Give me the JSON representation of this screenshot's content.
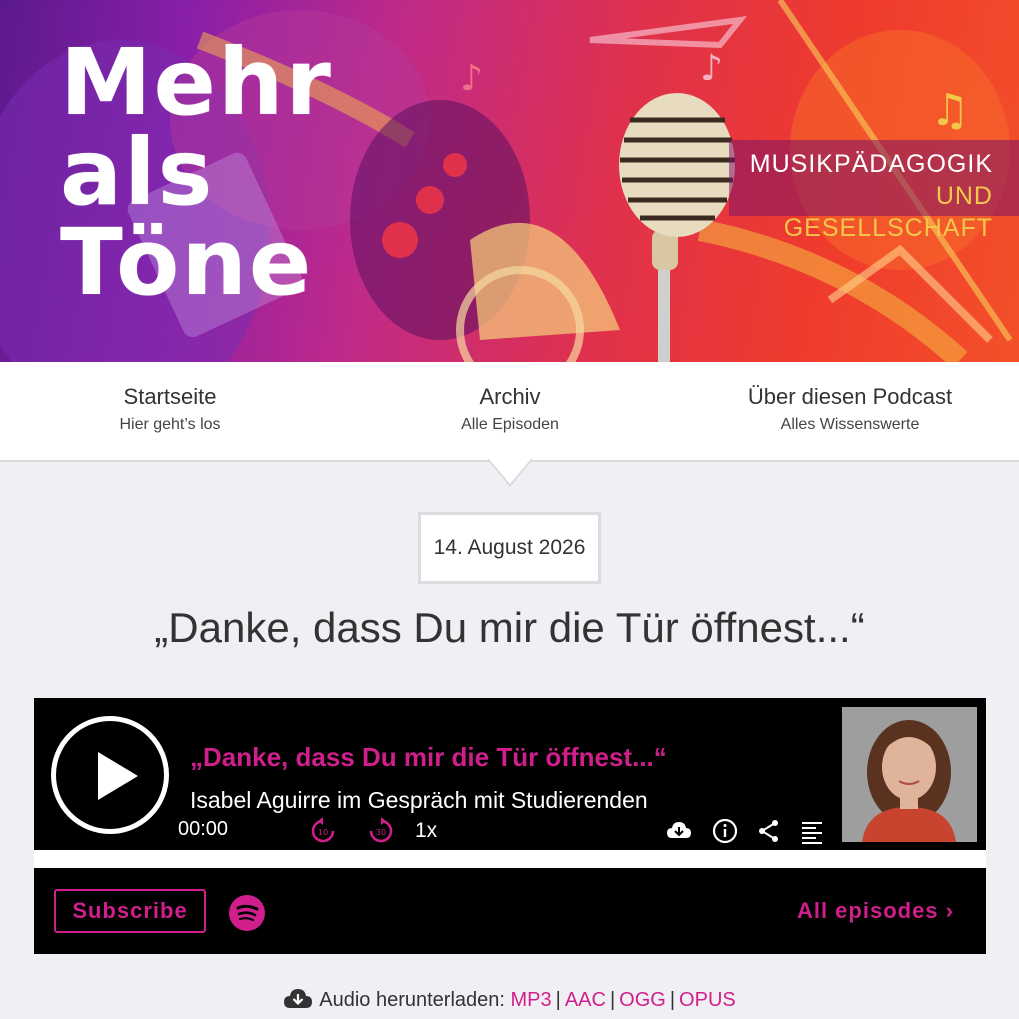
{
  "header": {
    "logo_lines": [
      "Mehr",
      "als",
      "Töne"
    ],
    "tagline_line1": "MUSIKPÄDAGOGIK",
    "tagline_line2": "UND GESELLSCHAFT"
  },
  "nav": {
    "items": [
      {
        "title": "Startseite",
        "subtitle": "Hier geht’s los"
      },
      {
        "title": "Archiv",
        "subtitle": "Alle Episoden"
      },
      {
        "title": "Über diesen Podcast",
        "subtitle": "Alles Wissenswerte"
      }
    ]
  },
  "episode": {
    "date": "14. August 2026",
    "title": "„Danke, dass Du mir die Tür öffnest...“"
  },
  "player": {
    "title": "„Danke, dass Du mir die Tür öffnest...“",
    "subtitle": "Isabel Aguirre im Gespräch mit Studierenden",
    "time": "00:00",
    "rewind_label": "10",
    "forward_label": "30",
    "speed": "1x"
  },
  "subscribe_bar": {
    "subscribe_label": "Subscribe",
    "all_episodes_label": "All episodes ›"
  },
  "download": {
    "label": "Audio herunterladen:",
    "formats": [
      "MP3",
      "AAC",
      "OGG",
      "OPUS"
    ]
  },
  "colors": {
    "accent": "#d01f8c",
    "tagline_gold": "#f2c84a",
    "player_bg": "#000000",
    "page_bg": "#f0f0f4"
  }
}
